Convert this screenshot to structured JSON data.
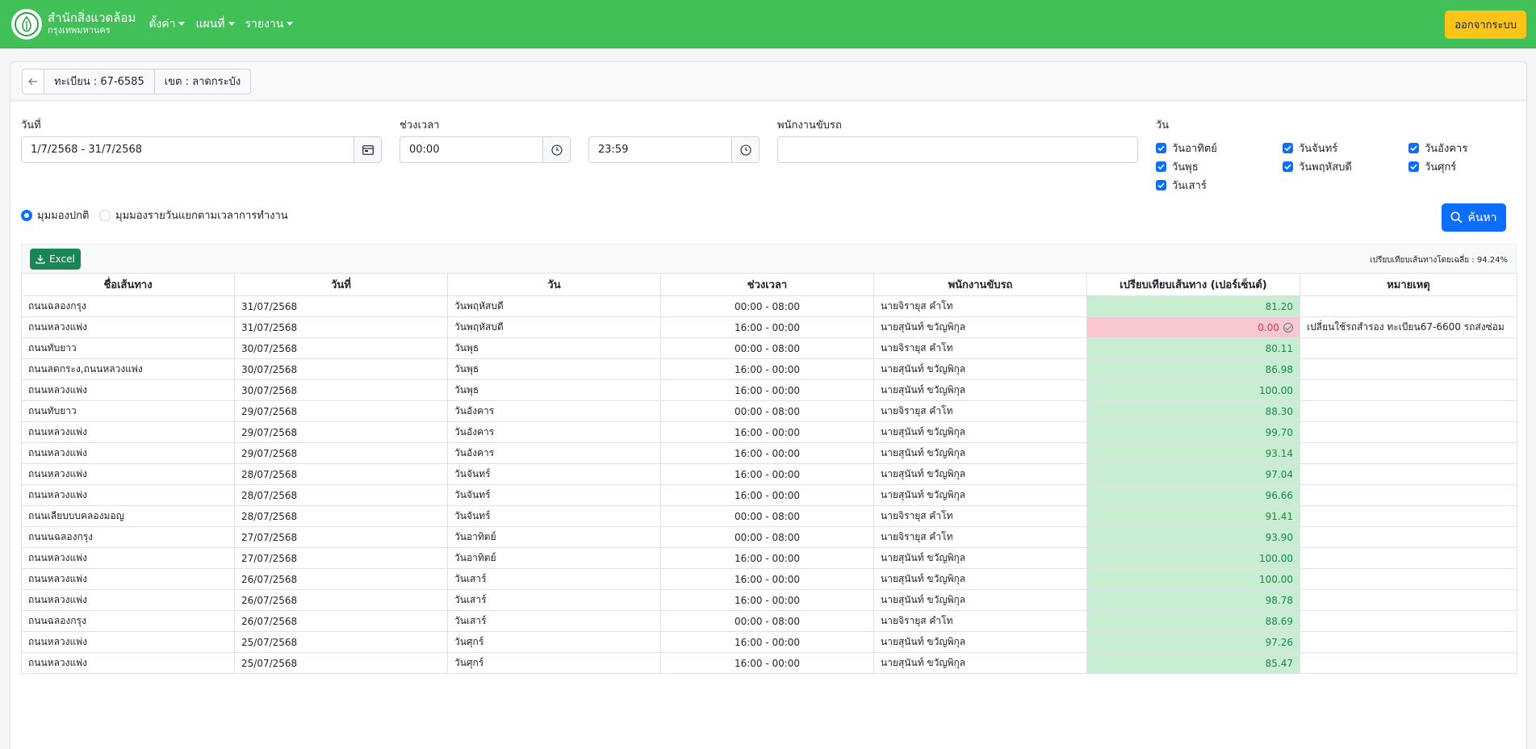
{
  "nav": {
    "brand_line1": "สำนักสิ่งแวดล้อม",
    "brand_line2": "กรุงเทพมหานคร",
    "menu": [
      "ตั้งค่า",
      "แผนที่",
      "รายงาน"
    ],
    "logout": "ออกจากระบบ"
  },
  "header": {
    "plate": "ทะเบียน : 67-6585",
    "district": "เขต : ลาดกระบัง"
  },
  "filters": {
    "date_label": "วันที่",
    "date_value": "1/7/2568 - 31/7/2568",
    "time_label": "ช่วงเวลา",
    "time_from": "00:00",
    "time_to": "23:59",
    "driver_label": "พนักงานขับรถ",
    "driver_value": "",
    "day_label": "วัน",
    "days": [
      {
        "label": "วันอาทิตย์",
        "checked": true
      },
      {
        "label": "วันจันทร์",
        "checked": true
      },
      {
        "label": "วันอังคาร",
        "checked": true
      },
      {
        "label": "วันพุธ",
        "checked": true
      },
      {
        "label": "วันพฤหัสบดี",
        "checked": true
      },
      {
        "label": "วันศุกร์",
        "checked": true
      },
      {
        "label": "วันเสาร์",
        "checked": true
      }
    ],
    "view_normal": "มุมมองปกติ",
    "view_daily": "มุมมองรายวันแยกตามเวลาการทำงาน",
    "search_label": "ค้นหา"
  },
  "toolbar": {
    "excel_label": "Excel",
    "average_text": "เปรียบเทียบเส้นทางโดยเฉลี่ย : 94.24%"
  },
  "table": {
    "columns": [
      "ชื่อเส้นทาง",
      "วันที่",
      "วัน",
      "ช่วงเวลา",
      "พนักงานขับรถ",
      "เปรียบเทียบเส้นทาง (เปอร์เซ็นต์)",
      "หมายเหตุ"
    ],
    "rows": [
      {
        "route": "ถนนฉลองกรุง",
        "date": "31/07/2568",
        "day": "วันพฤหัสบดี",
        "time": "00:00 - 08:00",
        "driver": "นายจิรายุส คำโท",
        "pct": "81.20",
        "status": "good",
        "note": ""
      },
      {
        "route": "ถนนหลวงแพ่ง",
        "date": "31/07/2568",
        "day": "วันพฤหัสบดี",
        "time": "16:00 - 00:00",
        "driver": "นายสุนันท์ ขวัญพิกุล",
        "pct": "0.00",
        "status": "bad",
        "note": "เปลี่ยนใช้รถสำรอง ทะเบียน67-6600 รถส่งซ่อม"
      },
      {
        "route": "ถนนทับยาว",
        "date": "30/07/2568",
        "day": "วันพุธ",
        "time": "00:00 - 08:00",
        "driver": "นายจิรายุส คำโท",
        "pct": "80.11",
        "status": "good",
        "note": ""
      },
      {
        "route": "ถนนลดกระง,ถนนหลวงแพ่ง",
        "date": "30/07/2568",
        "day": "วันพุธ",
        "time": "16:00 - 00:00",
        "driver": "นายสุนันท์ ขวัญพิกุล",
        "pct": "86.98",
        "status": "good",
        "note": ""
      },
      {
        "route": "ถนนหลวงแพ่ง",
        "date": "30/07/2568",
        "day": "วันพุธ",
        "time": "16:00 - 00:00",
        "driver": "นายสุนันท์ ขวัญพิกุล",
        "pct": "100.00",
        "status": "good",
        "note": ""
      },
      {
        "route": "ถนนทับยาว",
        "date": "29/07/2568",
        "day": "วันอังคาร",
        "time": "00:00 - 08:00",
        "driver": "นายจิรายุส คำโท",
        "pct": "88.30",
        "status": "good",
        "note": ""
      },
      {
        "route": "ถนนหลวงแพ่ง",
        "date": "29/07/2568",
        "day": "วันอังคาร",
        "time": "16:00 - 00:00",
        "driver": "นายสุนันท์ ขวัญพิกุล",
        "pct": "99.70",
        "status": "good",
        "note": ""
      },
      {
        "route": "ถนนหลวงแพ่ง",
        "date": "29/07/2568",
        "day": "วันอังคาร",
        "time": "16:00 - 00:00",
        "driver": "นายสุนันท์ ขวัญพิกุล",
        "pct": "93.14",
        "status": "good",
        "note": ""
      },
      {
        "route": "ถนนหลวงแพ่ง",
        "date": "28/07/2568",
        "day": "วันจันทร์",
        "time": "16:00 - 00:00",
        "driver": "นายสุนันท์ ขวัญพิกุล",
        "pct": "97.04",
        "status": "good",
        "note": ""
      },
      {
        "route": "ถนนหลวงแพ่ง",
        "date": "28/07/2568",
        "day": "วันจันทร์",
        "time": "16:00 - 00:00",
        "driver": "นายสุนันท์ ขวัญพิกุล",
        "pct": "96.66",
        "status": "good",
        "note": ""
      },
      {
        "route": "ถนนเลียบบบคลองมอญ",
        "date": "28/07/2568",
        "day": "วันจันทร์",
        "time": "00:00 - 08:00",
        "driver": "นายจิรายุส คำโท",
        "pct": "91.41",
        "status": "good",
        "note": ""
      },
      {
        "route": "ถนนนฉลองกรุง",
        "date": "27/07/2568",
        "day": "วันอาทิตย์",
        "time": "00:00 - 08:00",
        "driver": "นายจิรายุส คำโท",
        "pct": "93.90",
        "status": "good",
        "note": ""
      },
      {
        "route": "ถนนหลวงแพ่ง",
        "date": "27/07/2568",
        "day": "วันอาทิตย์",
        "time": "16:00 - 00:00",
        "driver": "นายสุนันท์ ขวัญพิกุล",
        "pct": "100.00",
        "status": "good",
        "note": ""
      },
      {
        "route": "ถนนหลวงแพ่ง",
        "date": "26/07/2568",
        "day": "วันเสาร์",
        "time": "16:00 - 00:00",
        "driver": "นายสุนันท์ ขวัญพิกุล",
        "pct": "100.00",
        "status": "good",
        "note": ""
      },
      {
        "route": "ถนนหลวงแพ่ง",
        "date": "26/07/2568",
        "day": "วันเสาร์",
        "time": "16:00 - 00:00",
        "driver": "นายสุนันท์ ขวัญพิกุล",
        "pct": "98.78",
        "status": "good",
        "note": ""
      },
      {
        "route": "ถนนฉลองกรุง",
        "date": "26/07/2568",
        "day": "วันเสาร์",
        "time": "00:00 - 08:00",
        "driver": "นายจิรายุส คำโท",
        "pct": "88.69",
        "status": "good",
        "note": ""
      },
      {
        "route": "ถนนหลวงแพ่ง",
        "date": "25/07/2568",
        "day": "วันศุกร์",
        "time": "16:00 - 00:00",
        "driver": "นายสุนันท์ ขวัญพิกุล",
        "pct": "97.26",
        "status": "good",
        "note": ""
      },
      {
        "route": "ถนนหลวงแพ่ง",
        "date": "25/07/2568",
        "day": "วันศุกร์",
        "time": "16:00 - 00:00",
        "driver": "นายสุนันท์ ขวัญพิกุล",
        "pct": "85.47",
        "status": "good",
        "note": ""
      }
    ]
  }
}
